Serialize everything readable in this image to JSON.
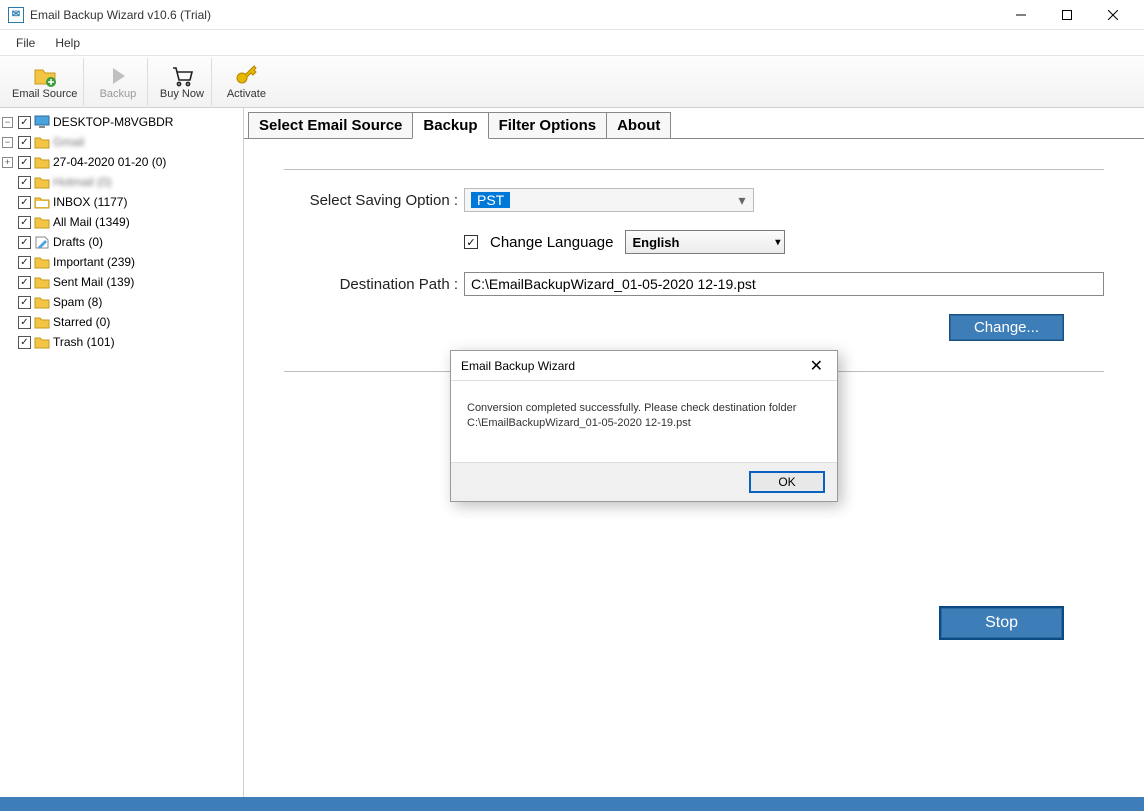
{
  "title": "Email Backup Wizard v10.6 (Trial)",
  "menu": {
    "file": "File",
    "help": "Help"
  },
  "toolbar": {
    "emailSource": "Email Source",
    "backup": "Backup",
    "buyNow": "Buy Now",
    "activate": "Activate"
  },
  "tree": {
    "root": "DESKTOP-M8VGBDR",
    "account": "Gmail",
    "items": [
      "27-04-2020 01-20 (0)",
      "Hotmail (0)",
      "INBOX (1177)",
      "All Mail (1349)",
      "Drafts (0)",
      "Important (239)",
      "Sent Mail (139)",
      "Spam (8)",
      "Starred (0)",
      "Trash (101)"
    ]
  },
  "tabs": {
    "selectSource": "Select Email Source",
    "backup": "Backup",
    "filter": "Filter Options",
    "about": "About"
  },
  "form": {
    "savingLabel": "Select Saving Option :",
    "savingValue": "PST",
    "changeLang": "Change Language",
    "langValue": "English",
    "destLabel": "Destination Path :",
    "destValue": "C:\\EmailBackupWizard_01-05-2020 12-19.pst",
    "changeBtn": "Change...",
    "stopBtn": "Stop"
  },
  "dialog": {
    "title": "Email Backup Wizard",
    "body1": "Conversion completed successfully. Please check destination folder",
    "body2": "C:\\EmailBackupWizard_01-05-2020 12-19.pst",
    "ok": "OK"
  }
}
